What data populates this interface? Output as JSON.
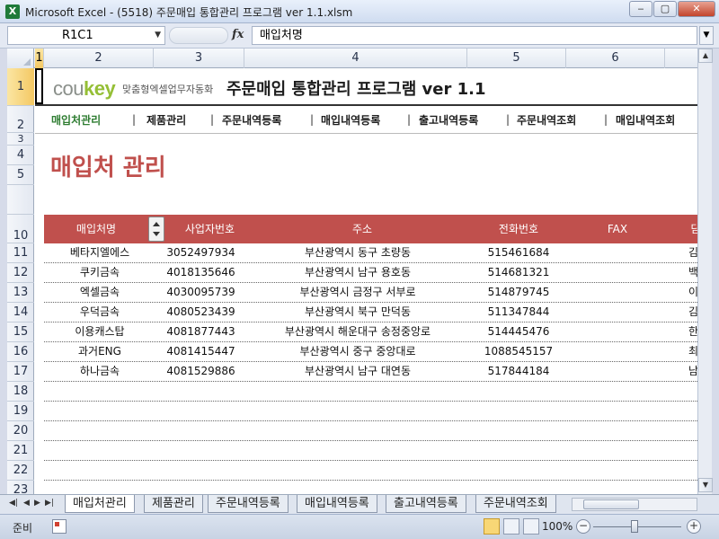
{
  "window": {
    "title": "Microsoft Excel - (5518) 주문매입 통합관리 프로그램 ver 1.1.xlsm",
    "app_icon": "X",
    "minimize": "‒",
    "maximize": "▢",
    "close": "✕"
  },
  "formula_bar": {
    "name_box": "R1C1",
    "fx": "fx",
    "formula": "매입처명"
  },
  "columns": [
    "1",
    "2",
    "3",
    "4",
    "5",
    "6"
  ],
  "rows": [
    "1",
    "2",
    "3",
    "4",
    "5",
    "",
    "10",
    "11",
    "12",
    "13",
    "14",
    "15",
    "16",
    "17",
    "18",
    "19",
    "20",
    "21",
    "22",
    "23"
  ],
  "brand": {
    "logo_main": "cou",
    "logo_accent": "key",
    "logo_sub": "맞춤형엑셀업무자동화",
    "app_title": "주문매입 통합관리 프로그램 ver 1.1"
  },
  "nav": {
    "items": [
      "매입처관리",
      "제품관리",
      "주문내역등록",
      "매입내역등록",
      "출고내역등록",
      "주문내역조회",
      "매입내역조회"
    ],
    "separator": "|",
    "active_index": 0
  },
  "section_title": "매입처 관리",
  "table": {
    "headers": [
      "매입처명",
      "사업자번호",
      "주소",
      "전화번호",
      "FAX",
      "담"
    ],
    "rows": [
      [
        "베타지엘에스",
        "3052497934",
        "부산광역시 동구 초량동",
        "515461684",
        "",
        "김"
      ],
      [
        "쿠키금속",
        "4018135646",
        "부산광역시 남구 용호동",
        "514681321",
        "",
        "백"
      ],
      [
        "엑셀금속",
        "4030095739",
        "부산광역시 금정구 서부로",
        "514879745",
        "",
        "이"
      ],
      [
        "우덕금속",
        "4080523439",
        "부산광역시 북구 만덕동",
        "511347844",
        "",
        "김"
      ],
      [
        "이용캐스탑",
        "4081877443",
        "부산광역시 해운대구 송정중앙로",
        "514445476",
        "",
        "한"
      ],
      [
        "과거ENG",
        "4081415447",
        "부산광역시 중구 중앙대로",
        "1088545157",
        "",
        "최"
      ],
      [
        "하나금속",
        "4081529886",
        "부산광역시 남구 대연동",
        "517844184",
        "",
        "남"
      ]
    ]
  },
  "sheet_tabs": [
    "매입처관리",
    "제품관리",
    "주문내역등록",
    "매입내역등록",
    "출고내역등록",
    "주문내역조회"
  ],
  "status": {
    "ready": "준비",
    "zoom": "100%",
    "zoom_minus": "−",
    "zoom_plus": "+"
  }
}
